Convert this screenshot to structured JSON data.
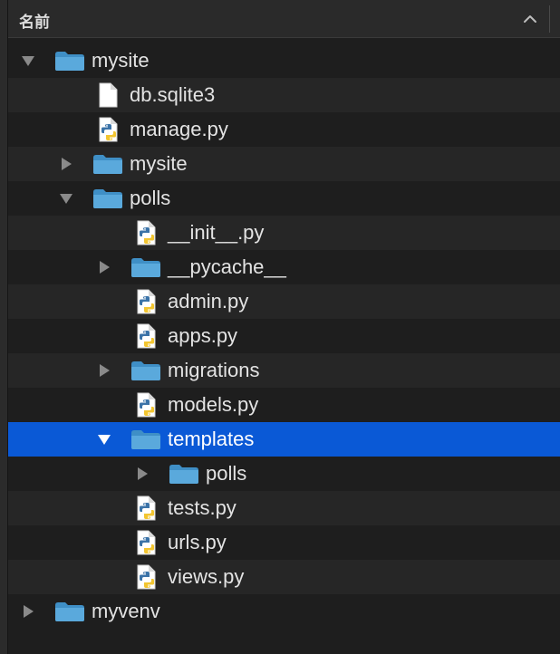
{
  "header": {
    "title": "名前",
    "sort_icon": "chevron-up-icon"
  },
  "colors": {
    "background": "#1e1e1e",
    "stripe": "#262626",
    "selection": "#0a59d6",
    "folder": "#5aa9dc",
    "text": "#e3e3e3"
  },
  "tree": [
    {
      "name": "mysite",
      "type": "folder",
      "depth": 0,
      "expanded": true
    },
    {
      "name": "db.sqlite3",
      "type": "file",
      "depth": 1
    },
    {
      "name": "manage.py",
      "type": "python",
      "depth": 1
    },
    {
      "name": "mysite",
      "type": "folder",
      "depth": 1,
      "expanded": false
    },
    {
      "name": "polls",
      "type": "folder",
      "depth": 1,
      "expanded": true
    },
    {
      "name": "__init__.py",
      "type": "python",
      "depth": 2
    },
    {
      "name": "__pycache__",
      "type": "folder",
      "depth": 2,
      "expanded": false
    },
    {
      "name": "admin.py",
      "type": "python",
      "depth": 2
    },
    {
      "name": "apps.py",
      "type": "python",
      "depth": 2
    },
    {
      "name": "migrations",
      "type": "folder",
      "depth": 2,
      "expanded": false
    },
    {
      "name": "models.py",
      "type": "python",
      "depth": 2
    },
    {
      "name": "templates",
      "type": "folder",
      "depth": 2,
      "expanded": true,
      "selected": true
    },
    {
      "name": "polls",
      "type": "folder",
      "depth": 3,
      "expanded": false
    },
    {
      "name": "tests.py",
      "type": "python",
      "depth": 2
    },
    {
      "name": "urls.py",
      "type": "python",
      "depth": 2
    },
    {
      "name": "views.py",
      "type": "python",
      "depth": 2
    },
    {
      "name": "myvenv",
      "type": "folder",
      "depth": 0,
      "expanded": false
    }
  ]
}
